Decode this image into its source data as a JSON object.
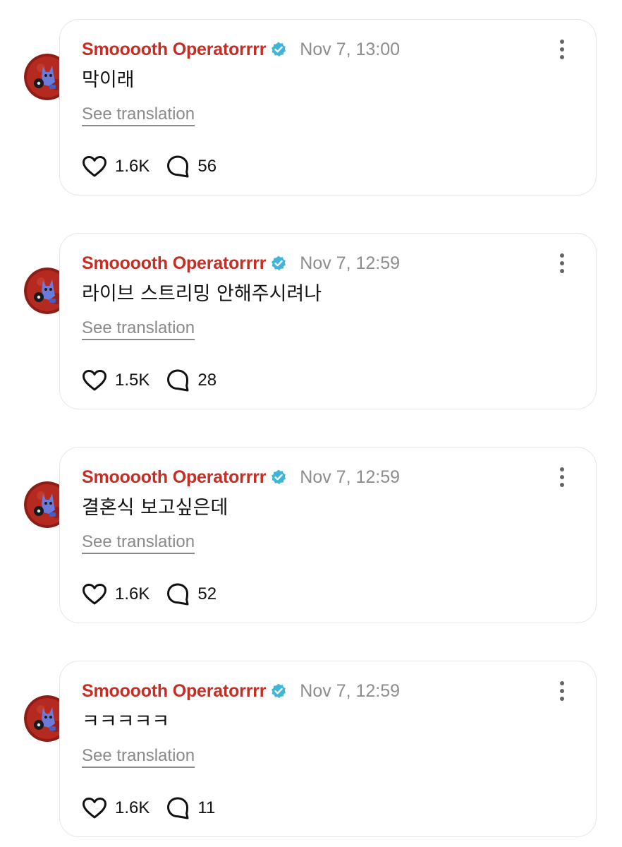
{
  "colors": {
    "author": "#c62d24",
    "timestamp": "#8d8d8d",
    "verified_badge": "#3fb6d8",
    "card_border": "#e6e6e6"
  },
  "icons": {
    "verified": "verified-badge-icon",
    "more": "more-vertical-icon",
    "like": "heart-icon",
    "comment": "speech-bubble-icon"
  },
  "posts": [
    {
      "author": "Smooooth Operatorrrr",
      "timestamp": "Nov 7, 13:00",
      "text": "막이래",
      "translate_label": "See translation",
      "likes": "1.6K",
      "comments": "56"
    },
    {
      "author": "Smooooth Operatorrrr",
      "timestamp": "Nov 7, 12:59",
      "text": "라이브 스트리밍 안해주시려나",
      "translate_label": "See translation",
      "likes": "1.5K",
      "comments": "28"
    },
    {
      "author": "Smooooth Operatorrrr",
      "timestamp": "Nov 7, 12:59",
      "text": "결혼식 보고싶은데",
      "translate_label": "See translation",
      "likes": "1.6K",
      "comments": "52"
    },
    {
      "author": "Smooooth Operatorrrr",
      "timestamp": "Nov 7, 12:59",
      "text": "ㅋㅋㅋㅋㅋ",
      "translate_label": "See translation",
      "likes": "1.6K",
      "comments": "11"
    }
  ]
}
